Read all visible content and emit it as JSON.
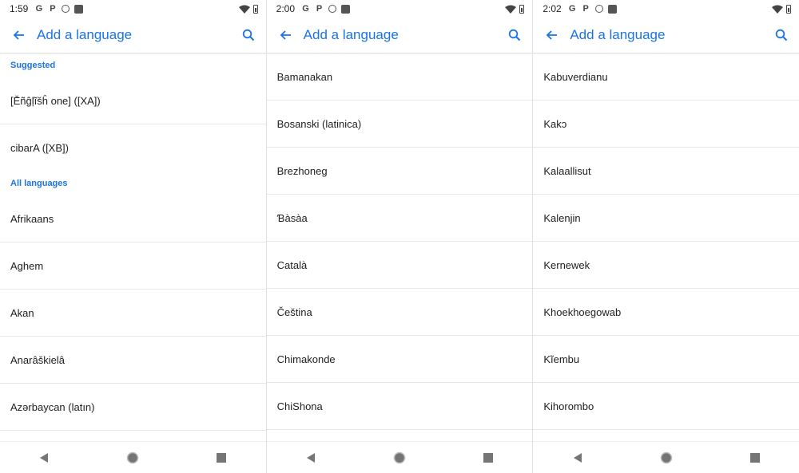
{
  "colors": {
    "accent": "#1a73e8",
    "text": "#202124",
    "divider": "#e6e6e6"
  },
  "panels": [
    {
      "status_time": "1:59",
      "status_icons": [
        "G",
        "P"
      ],
      "title": "Add a language",
      "sections": [
        {
          "header": "Suggested",
          "items": [
            "[Ĕñĝļĩšĥ one] ([XA])",
            "cibarA ([XB])"
          ]
        },
        {
          "header": "All languages",
          "items": [
            "Afrikaans",
            "Aghem",
            "Akan",
            "Anarâškielâ",
            "Azərbaycan (latın)"
          ]
        }
      ]
    },
    {
      "status_time": "2:00",
      "status_icons": [
        "G",
        "P"
      ],
      "title": "Add a language",
      "sections": [
        {
          "header": "",
          "items": [
            "Bamanakan",
            "Bosanski (latinica)",
            "Brezhoneg",
            "Ɓàsàa",
            "Català",
            "Čeština",
            "Chimakonde",
            "ChiShona"
          ]
        }
      ]
    },
    {
      "status_time": "2:02",
      "status_icons": [
        "G",
        "P"
      ],
      "title": "Add a language",
      "sections": [
        {
          "header": "",
          "items": [
            "Kabuverdianu",
            "Kakɔ",
            "Kalaallisut",
            "Kalenjin",
            "Kernewek",
            "Khoekhoegowab",
            "Kĩembu",
            "Kihorombo"
          ]
        }
      ]
    }
  ],
  "icons": {
    "back": "arrow-back-icon",
    "search": "search-icon",
    "nav_back": "triangle-back-icon",
    "nav_home": "circle-home-icon",
    "nav_recents": "square-recents-icon"
  }
}
